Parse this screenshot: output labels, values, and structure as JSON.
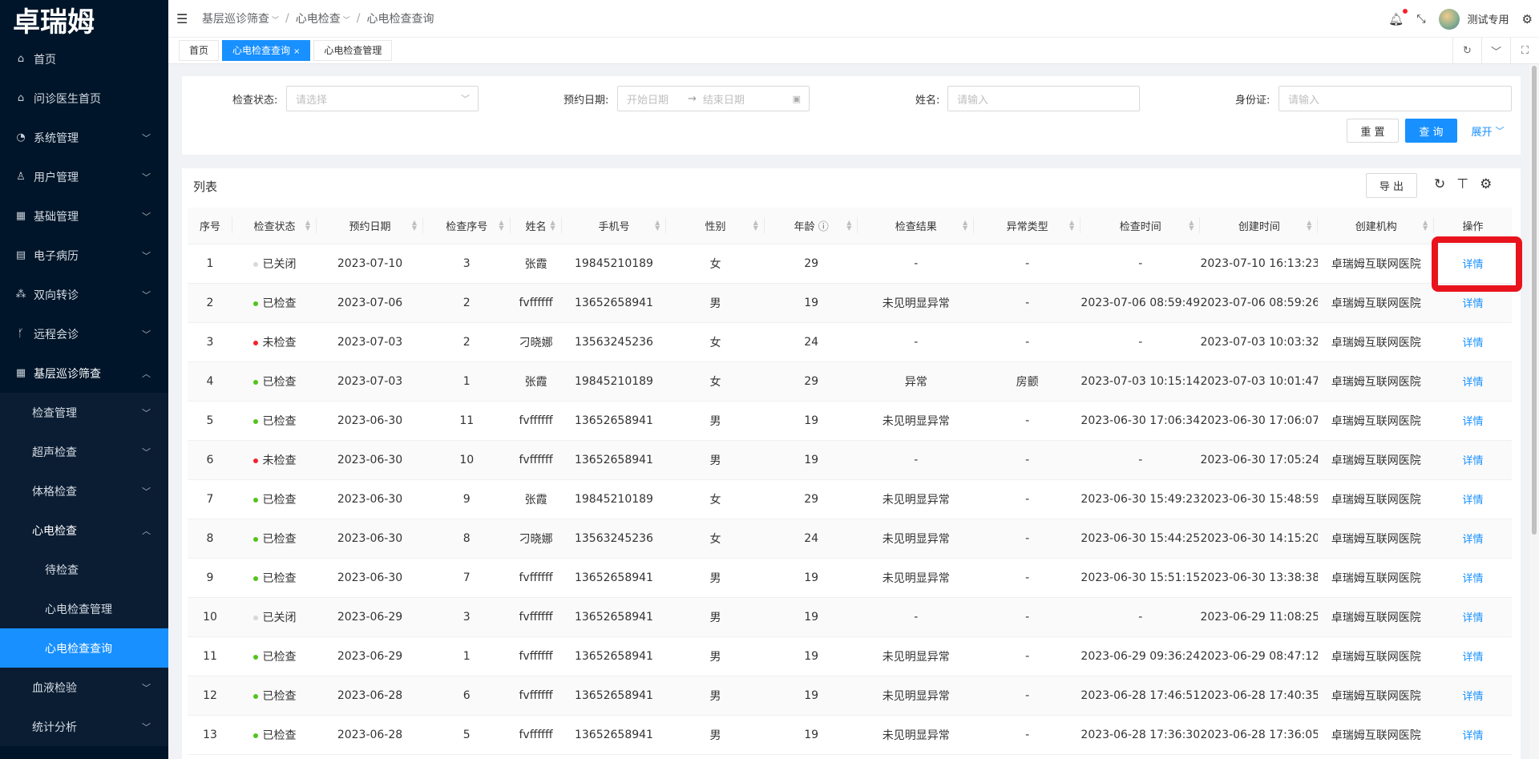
{
  "sidebar": {
    "logo": "卓瑞姆",
    "items": [
      {
        "label": "首页",
        "icon": "home-icon"
      },
      {
        "label": "问诊医生首页",
        "icon": "home-icon"
      },
      {
        "label": "系统管理",
        "icon": "dashboard-icon"
      },
      {
        "label": "用户管理",
        "icon": "user-icon"
      },
      {
        "label": "基础管理",
        "icon": "grid-icon"
      },
      {
        "label": "电子病历",
        "icon": "record-icon"
      },
      {
        "label": "双向转诊",
        "icon": "transfer-icon"
      },
      {
        "label": "远程会诊",
        "icon": "branch-icon"
      },
      {
        "label": "基层巡诊筛查",
        "icon": "grid-icon"
      }
    ],
    "sub": [
      "检查管理",
      "超声检查",
      "体格检查",
      "心电检查"
    ],
    "sub2": [
      "待检查",
      "心电检查管理",
      "心电检查查询"
    ],
    "after": [
      "血液检验",
      "统计分析"
    ]
  },
  "header": {
    "breadcrumb": [
      "基层巡诊筛查",
      "心电检查",
      "心电检查查询"
    ],
    "username": "测试专用"
  },
  "tabs": [
    "首页",
    "心电检查查询",
    "心电检查管理"
  ],
  "filters": {
    "status_label": "检查状态:",
    "status_placeholder": "请选择",
    "date_label": "预约日期:",
    "date_start": "开始日期",
    "date_end": "结束日期",
    "name_label": "姓名:",
    "name_placeholder": "请输入",
    "id_label": "身份证:",
    "id_placeholder": "请输入",
    "reset": "重 置",
    "search": "查 询",
    "expand": "展开"
  },
  "table": {
    "title": "列表",
    "export": "导 出",
    "columns": [
      "序号",
      "检查状态",
      "预约日期",
      "检查序号",
      "姓名",
      "手机号",
      "性别",
      "年龄",
      "检查结果",
      "异常类型",
      "检查时间",
      "创建时间",
      "创建机构",
      "操作"
    ],
    "action_label": "详情",
    "status_colors": {
      "已关闭": "#d9d9d9",
      "已检查": "#52c41a",
      "未检查": "#f5222d"
    },
    "rows": [
      [
        "1",
        "已关闭",
        "2023-07-10",
        "3",
        "张霞",
        "19845210189",
        "女",
        "29",
        "-",
        "-",
        "-",
        "2023-07-10 16:13:23",
        "卓瑞姆互联网医院"
      ],
      [
        "2",
        "已检查",
        "2023-07-06",
        "2",
        "fvffffff",
        "13652658941",
        "男",
        "19",
        "未见明显异常",
        "-",
        "2023-07-06 08:59:49",
        "2023-07-06 08:59:26",
        "卓瑞姆互联网医院"
      ],
      [
        "3",
        "未检查",
        "2023-07-03",
        "2",
        "刁晓娜",
        "13563245236",
        "女",
        "24",
        "-",
        "-",
        "-",
        "2023-07-03 10:03:32",
        "卓瑞姆互联网医院"
      ],
      [
        "4",
        "已检查",
        "2023-07-03",
        "1",
        "张霞",
        "19845210189",
        "女",
        "29",
        "异常",
        "房颤",
        "2023-07-03 10:15:14",
        "2023-07-03 10:01:47",
        "卓瑞姆互联网医院"
      ],
      [
        "5",
        "已检查",
        "2023-06-30",
        "11",
        "fvffffff",
        "13652658941",
        "男",
        "19",
        "未见明显异常",
        "-",
        "2023-06-30 17:06:34",
        "2023-06-30 17:06:07",
        "卓瑞姆互联网医院"
      ],
      [
        "6",
        "未检查",
        "2023-06-30",
        "10",
        "fvffffff",
        "13652658941",
        "男",
        "19",
        "-",
        "-",
        "-",
        "2023-06-30 17:05:24",
        "卓瑞姆互联网医院"
      ],
      [
        "7",
        "已检查",
        "2023-06-30",
        "9",
        "张霞",
        "19845210189",
        "女",
        "29",
        "未见明显异常",
        "-",
        "2023-06-30 15:49:23",
        "2023-06-30 15:48:59",
        "卓瑞姆互联网医院"
      ],
      [
        "8",
        "已检查",
        "2023-06-30",
        "8",
        "刁晓娜",
        "13563245236",
        "女",
        "24",
        "未见明显异常",
        "-",
        "2023-06-30 15:44:25",
        "2023-06-30 14:15:20",
        "卓瑞姆互联网医院"
      ],
      [
        "9",
        "已检查",
        "2023-06-30",
        "7",
        "fvffffff",
        "13652658941",
        "男",
        "19",
        "未见明显异常",
        "-",
        "2023-06-30 15:51:15",
        "2023-06-30 13:38:38",
        "卓瑞姆互联网医院"
      ],
      [
        "10",
        "已关闭",
        "2023-06-29",
        "3",
        "fvffffff",
        "13652658941",
        "男",
        "19",
        "-",
        "-",
        "-",
        "2023-06-29 11:08:25",
        "卓瑞姆互联网医院"
      ],
      [
        "11",
        "已检查",
        "2023-06-29",
        "1",
        "fvffffff",
        "13652658941",
        "男",
        "19",
        "未见明显异常",
        "-",
        "2023-06-29 09:36:24",
        "2023-06-29 08:47:12",
        "卓瑞姆互联网医院"
      ],
      [
        "12",
        "已检查",
        "2023-06-28",
        "6",
        "fvffffff",
        "13652658941",
        "男",
        "19",
        "未见明显异常",
        "-",
        "2023-06-28 17:46:51",
        "2023-06-28 17:40:35",
        "卓瑞姆互联网医院"
      ],
      [
        "13",
        "已检查",
        "2023-06-28",
        "5",
        "fvffffff",
        "13652658941",
        "男",
        "19",
        "未见明显异常",
        "-",
        "2023-06-28 17:36:30",
        "2023-06-28 17:36:05",
        "卓瑞姆互联网医院"
      ]
    ]
  }
}
